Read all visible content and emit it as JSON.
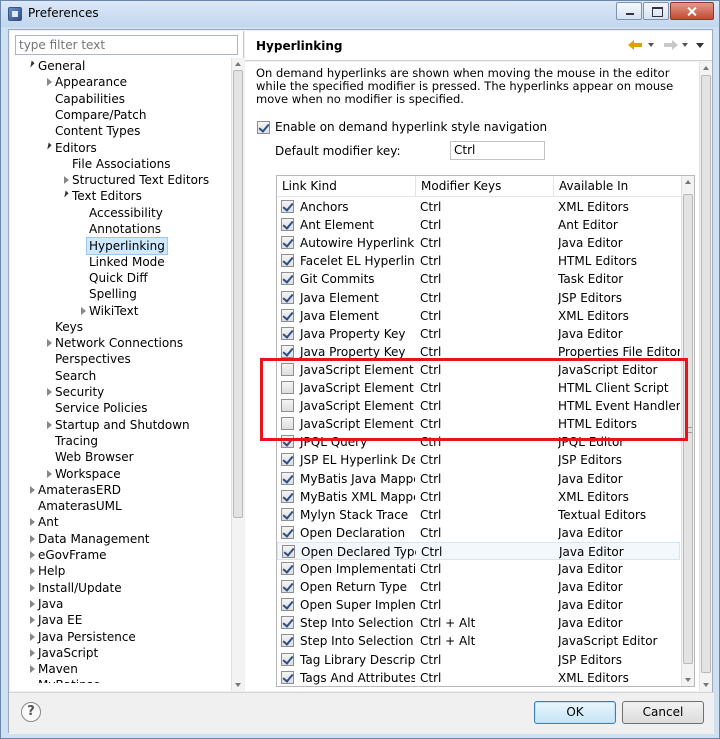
{
  "window": {
    "title": "Preferences"
  },
  "filter": {
    "placeholder": "type filter text"
  },
  "tree": [
    {
      "label": "General",
      "depth": 0,
      "tw": "open"
    },
    {
      "label": "Appearance",
      "depth": 1,
      "tw": "closed"
    },
    {
      "label": "Capabilities",
      "depth": 1,
      "tw": ""
    },
    {
      "label": "Compare/Patch",
      "depth": 1,
      "tw": ""
    },
    {
      "label": "Content Types",
      "depth": 1,
      "tw": ""
    },
    {
      "label": "Editors",
      "depth": 1,
      "tw": "open"
    },
    {
      "label": "File Associations",
      "depth": 2,
      "tw": ""
    },
    {
      "label": "Structured Text Editors",
      "depth": 2,
      "tw": "closed"
    },
    {
      "label": "Text Editors",
      "depth": 2,
      "tw": "open"
    },
    {
      "label": "Accessibility",
      "depth": 3,
      "tw": ""
    },
    {
      "label": "Annotations",
      "depth": 3,
      "tw": ""
    },
    {
      "label": "Hyperlinking",
      "depth": 3,
      "tw": "",
      "selected": true
    },
    {
      "label": "Linked Mode",
      "depth": 3,
      "tw": ""
    },
    {
      "label": "Quick Diff",
      "depth": 3,
      "tw": ""
    },
    {
      "label": "Spelling",
      "depth": 3,
      "tw": ""
    },
    {
      "label": "WikiText",
      "depth": 3,
      "tw": "closed"
    },
    {
      "label": "Keys",
      "depth": 1,
      "tw": ""
    },
    {
      "label": "Network Connections",
      "depth": 1,
      "tw": "closed"
    },
    {
      "label": "Perspectives",
      "depth": 1,
      "tw": ""
    },
    {
      "label": "Search",
      "depth": 1,
      "tw": ""
    },
    {
      "label": "Security",
      "depth": 1,
      "tw": "closed"
    },
    {
      "label": "Service Policies",
      "depth": 1,
      "tw": ""
    },
    {
      "label": "Startup and Shutdown",
      "depth": 1,
      "tw": "closed"
    },
    {
      "label": "Tracing",
      "depth": 1,
      "tw": ""
    },
    {
      "label": "Web Browser",
      "depth": 1,
      "tw": ""
    },
    {
      "label": "Workspace",
      "depth": 1,
      "tw": "closed"
    },
    {
      "label": "AmaterasERD",
      "depth": 0,
      "tw": "closed"
    },
    {
      "label": "AmaterasUML",
      "depth": 0,
      "tw": ""
    },
    {
      "label": "Ant",
      "depth": 0,
      "tw": "closed"
    },
    {
      "label": "Data Management",
      "depth": 0,
      "tw": "closed"
    },
    {
      "label": "eGovFrame",
      "depth": 0,
      "tw": "closed"
    },
    {
      "label": "Help",
      "depth": 0,
      "tw": "closed"
    },
    {
      "label": "Install/Update",
      "depth": 0,
      "tw": "closed"
    },
    {
      "label": "Java",
      "depth": 0,
      "tw": "closed"
    },
    {
      "label": "Java EE",
      "depth": 0,
      "tw": "closed"
    },
    {
      "label": "Java Persistence",
      "depth": 0,
      "tw": "closed"
    },
    {
      "label": "JavaScript",
      "depth": 0,
      "tw": "closed"
    },
    {
      "label": "Maven",
      "depth": 0,
      "tw": "closed"
    },
    {
      "label": "MyBatipse",
      "depth": 0,
      "tw": ""
    }
  ],
  "page": {
    "title": "Hyperlinking",
    "description": "On demand hyperlinks are shown when moving the mouse in the editor while the specified modifier is pressed. The hyperlinks appear on mouse move when no modifier is specified.",
    "enable_label": "Enable on demand hyperlink style navigation",
    "enable_checked": true,
    "modifier_label": "Default modifier key:",
    "modifier_value": "Ctrl"
  },
  "table": {
    "headers": [
      "Link Kind",
      "Modifier Keys",
      "Available In"
    ],
    "rows": [
      {
        "kind": "Anchors",
        "mod": "Ctrl",
        "avail": "XML Editors",
        "on": true
      },
      {
        "kind": "Ant Element",
        "mod": "Ctrl",
        "avail": "Ant Editor",
        "on": true
      },
      {
        "kind": "Autowire Hyperlink ...",
        "mod": "Ctrl",
        "avail": "Java Editor",
        "on": true
      },
      {
        "kind": "Facelet EL Hyperlink ...",
        "mod": "Ctrl",
        "avail": "HTML Editors",
        "on": true
      },
      {
        "kind": "Git Commits",
        "mod": "Ctrl",
        "avail": "Task Editor",
        "on": true
      },
      {
        "kind": "Java Element",
        "mod": "Ctrl",
        "avail": "JSP Editors",
        "on": true
      },
      {
        "kind": "Java Element",
        "mod": "Ctrl",
        "avail": "XML Editors",
        "on": true
      },
      {
        "kind": "Java Property Key",
        "mod": "Ctrl",
        "avail": "Java Editor",
        "on": true
      },
      {
        "kind": "Java Property Key",
        "mod": "Ctrl",
        "avail": "Properties File Editor",
        "on": true
      },
      {
        "kind": "JavaScript Element",
        "mod": "Ctrl",
        "avail": "JavaScript Editor",
        "on": false
      },
      {
        "kind": "JavaScript Element",
        "mod": "Ctrl",
        "avail": "HTML Client Script",
        "on": false
      },
      {
        "kind": "JavaScript Element",
        "mod": "Ctrl",
        "avail": "HTML Event Handlers",
        "on": false
      },
      {
        "kind": "JavaScript Element",
        "mod": "Ctrl",
        "avail": "HTML Editors",
        "on": false
      },
      {
        "kind": "JPQL Query",
        "mod": "Ctrl",
        "avail": "JPQL Editor",
        "on": true
      },
      {
        "kind": "JSP EL Hyperlink Det...",
        "mod": "Ctrl",
        "avail": "JSP Editors",
        "on": true
      },
      {
        "kind": "MyBatis Java Mappe...",
        "mod": "Ctrl",
        "avail": "Java Editor",
        "on": true
      },
      {
        "kind": "MyBatis XML Mappe...",
        "mod": "Ctrl",
        "avail": "XML Editors",
        "on": true
      },
      {
        "kind": "Mylyn Stack Trace",
        "mod": "Ctrl",
        "avail": "Textual Editors",
        "on": true
      },
      {
        "kind": "Open Declaration",
        "mod": "Ctrl",
        "avail": "Java Editor",
        "on": true
      },
      {
        "kind": "Open Declared Type",
        "mod": "Ctrl",
        "avail": "Java Editor",
        "on": true,
        "hl": true
      },
      {
        "kind": "Open Implementation",
        "mod": "Ctrl",
        "avail": "Java Editor",
        "on": true
      },
      {
        "kind": "Open Return Type",
        "mod": "Ctrl",
        "avail": "Java Editor",
        "on": true
      },
      {
        "kind": "Open Super Impleme...",
        "mod": "Ctrl",
        "avail": "Java Editor",
        "on": true
      },
      {
        "kind": "Step Into Selection",
        "mod": "Ctrl + Alt",
        "avail": "Java Editor",
        "on": true
      },
      {
        "kind": "Step Into Selection",
        "mod": "Ctrl + Alt",
        "avail": "JavaScript Editor",
        "on": true
      },
      {
        "kind": "Tag Library Descriptor",
        "mod": "Ctrl",
        "avail": "JSP Editors",
        "on": true
      },
      {
        "kind": "Tags And Attributes",
        "mod": "Ctrl",
        "avail": "XML Editors",
        "on": true
      }
    ]
  },
  "buttons": {
    "help": "?",
    "ok": "OK",
    "cancel": "Cancel"
  }
}
